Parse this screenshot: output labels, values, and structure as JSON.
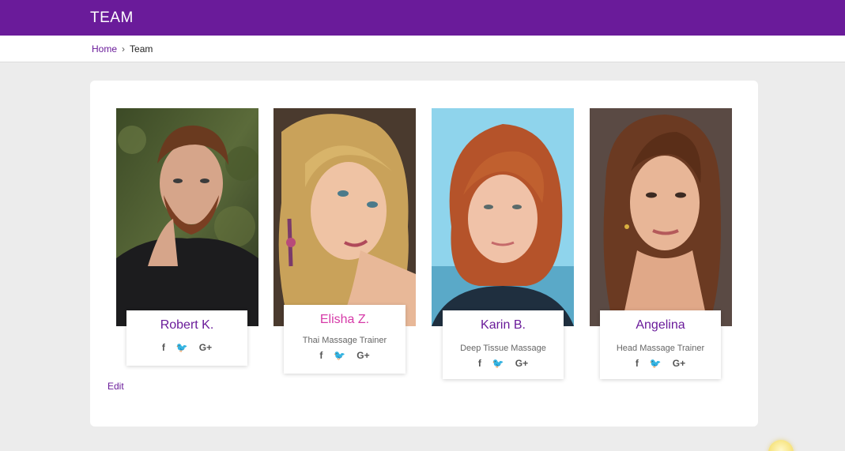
{
  "header": {
    "title": "TEAM"
  },
  "breadcrumb": {
    "home": "Home",
    "current": "Team"
  },
  "team": [
    {
      "name": "Robert K.",
      "role": ""
    },
    {
      "name": "Elisha Z.",
      "role": "Thai Massage Trainer"
    },
    {
      "name": "Karin B.",
      "role": "Deep Tissue Massage"
    },
    {
      "name": "Angelina",
      "role": "Head Massage Trainer"
    }
  ],
  "socials": {
    "facebook": "f",
    "twitter": "🐦",
    "google": "G+"
  },
  "edit_label": "Edit",
  "colors": {
    "brand": "#6a1b9a",
    "highlight": "#d63aa8"
  }
}
